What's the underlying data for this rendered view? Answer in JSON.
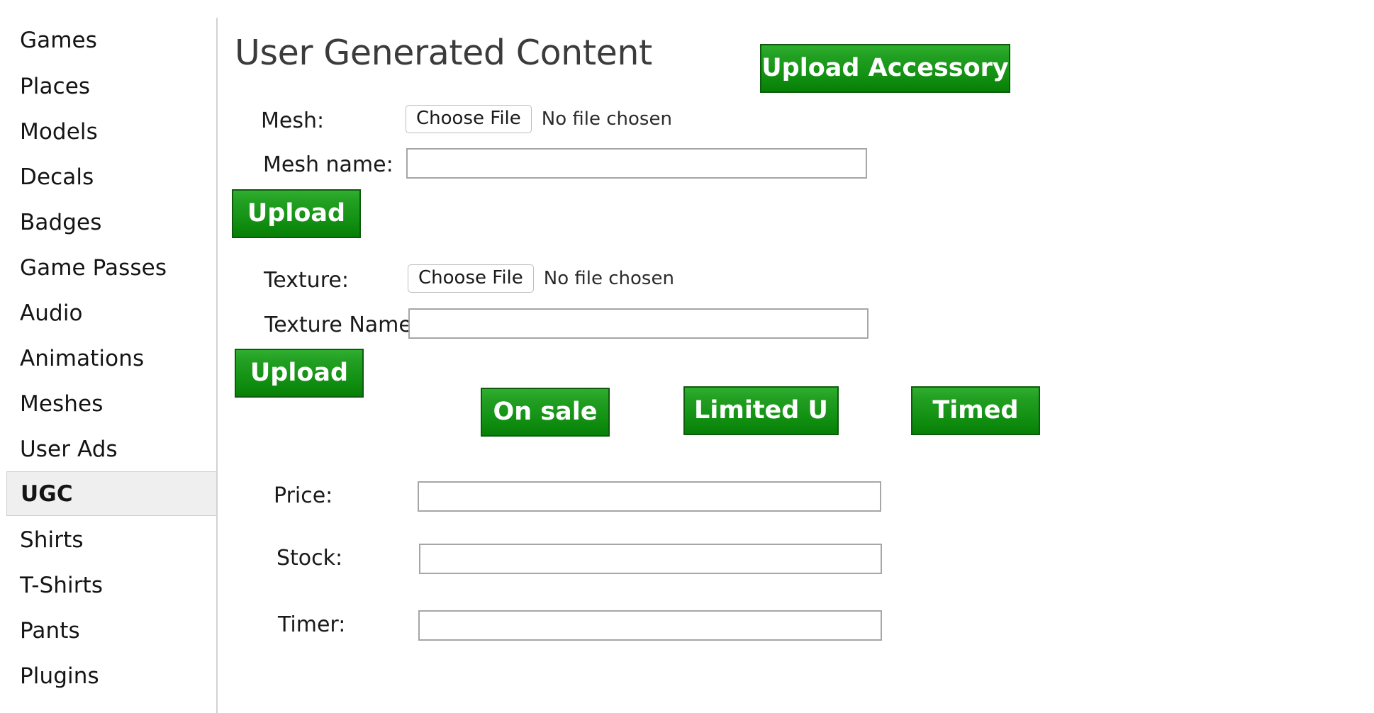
{
  "sidebar": {
    "items": [
      {
        "label": "Games",
        "active": false
      },
      {
        "label": "Places",
        "active": false
      },
      {
        "label": "Models",
        "active": false
      },
      {
        "label": "Decals",
        "active": false
      },
      {
        "label": "Badges",
        "active": false
      },
      {
        "label": "Game Passes",
        "active": false
      },
      {
        "label": "Audio",
        "active": false
      },
      {
        "label": "Animations",
        "active": false
      },
      {
        "label": "Meshes",
        "active": false
      },
      {
        "label": "User Ads",
        "active": false
      },
      {
        "label": "UGC",
        "active": true
      },
      {
        "label": "Shirts",
        "active": false
      },
      {
        "label": "T-Shirts",
        "active": false
      },
      {
        "label": "Pants",
        "active": false
      },
      {
        "label": "Plugins",
        "active": false
      }
    ]
  },
  "header": {
    "title": "User Generated Content",
    "upload_accessory_label": "Upload Accessory"
  },
  "mesh_section": {
    "mesh_label": "Mesh:",
    "choose_file_label": "Choose File",
    "no_file_text": "No file chosen",
    "mesh_name_label": "Mesh name:",
    "mesh_name_value": "",
    "mesh_name_placeholder": "",
    "upload_label": "Upload"
  },
  "texture_section": {
    "texture_label": "Texture:",
    "choose_file_label": "Choose File",
    "no_file_text": "No file chosen",
    "texture_name_label": "Texture Name:",
    "texture_name_value": "",
    "texture_name_placeholder": "",
    "upload_label": "Upload"
  },
  "toggles": {
    "on_sale_label": "On sale",
    "limited_u_label": "Limited U",
    "timed_label": "Timed"
  },
  "details_section": {
    "price_label": "Price:",
    "price_value": "",
    "price_placeholder": "",
    "stock_label": "Stock:",
    "stock_value": "",
    "stock_placeholder": "",
    "timer_label": "Timer:",
    "timer_value": "",
    "timer_placeholder": ""
  },
  "colors": {
    "button_green_top": "#2fae2f",
    "button_green_bottom": "#068006",
    "button_border_green": "#0d5c0d",
    "active_nav_bg": "#efefef",
    "active_nav_border": "#cfcfcf",
    "input_border": "#a6a6a6",
    "title_text": "#3b3b3b",
    "divider": "#d2d2d2"
  }
}
